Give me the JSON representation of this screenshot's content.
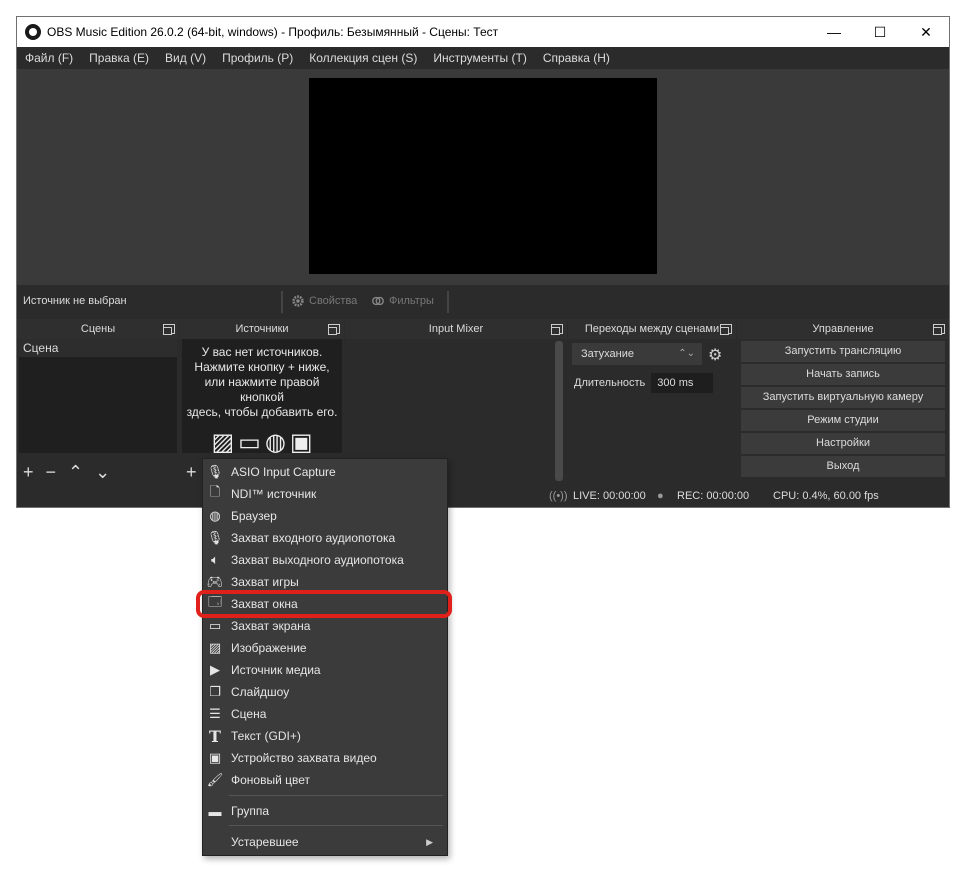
{
  "window": {
    "title": "OBS Music Edition 26.0.2 (64-bit, windows) - Профиль: Безымянный - Сцены: Тест",
    "controls": {
      "minimize": "—",
      "maximize": "☐",
      "close": "✕"
    }
  },
  "menubar": [
    "Файл (F)",
    "Правка (E)",
    "Вид (V)",
    "Профиль (P)",
    "Коллекция сцен (S)",
    "Инструменты (T)",
    "Справка (H)"
  ],
  "source_toolbar": {
    "status": "Источник не выбран",
    "properties": "Свойства",
    "filters": "Фильтры"
  },
  "docks": {
    "scenes": {
      "title": "Сцены",
      "items": [
        "Сцена"
      ]
    },
    "sources": {
      "title": "Источники",
      "empty_line1": "У вас нет источников.",
      "empty_line2": "Нажмите кнопку + ниже,",
      "empty_line3": "или нажмите правой кнопкой",
      "empty_line4": "здесь, чтобы добавить его."
    },
    "mixer": {
      "title": "Input Mixer"
    },
    "transitions": {
      "title": "Переходы между сценами",
      "selected": "Затухание",
      "duration_label": "Длительность",
      "duration_value": "300 ms"
    },
    "controls": {
      "title": "Управление",
      "buttons": [
        "Запустить трансляцию",
        "Начать запись",
        "Запустить виртуальную камеру",
        "Режим студии",
        "Настройки",
        "Выход"
      ]
    }
  },
  "statusbar": {
    "live": "LIVE: 00:00:00",
    "rec": "REC: 00:00:00",
    "cpu": "CPU: 0.4%, 60.00 fps"
  },
  "context_menu": {
    "items": [
      {
        "label": "ASIO Input Capture",
        "icon": "microphone-icon"
      },
      {
        "label": "NDI™ источник",
        "icon": "file-icon"
      },
      {
        "label": "Браузер",
        "icon": "globe-icon"
      },
      {
        "label": "Захват входного аудиопотока",
        "icon": "microphone-icon"
      },
      {
        "label": "Захват выходного аудиопотока",
        "icon": "speaker-icon"
      },
      {
        "label": "Захват игры",
        "icon": "gamepad-icon"
      },
      {
        "label": "Захват окна",
        "icon": "window-icon"
      },
      {
        "label": "Захват экрана",
        "icon": "monitor-icon"
      },
      {
        "label": "Изображение",
        "icon": "image-icon"
      },
      {
        "label": "Источник медиа",
        "icon": "play-icon"
      },
      {
        "label": "Слайдшоу",
        "icon": "slideshow-icon"
      },
      {
        "label": "Сцена",
        "icon": "list-icon"
      },
      {
        "label": "Текст (GDI+)",
        "icon": "text-icon"
      },
      {
        "label": "Устройство захвата видео",
        "icon": "camera-icon"
      },
      {
        "label": "Фоновый цвет",
        "icon": "brush-icon"
      }
    ],
    "group": {
      "label": "Группа",
      "icon": "folder-icon"
    },
    "deprecated": {
      "label": "Устаревшее"
    },
    "highlighted": "Захват окна"
  },
  "colors": {
    "highlight_ring": "#e0201a",
    "background": "#2b2b2b",
    "menu_bg": "#3b3b3b"
  }
}
